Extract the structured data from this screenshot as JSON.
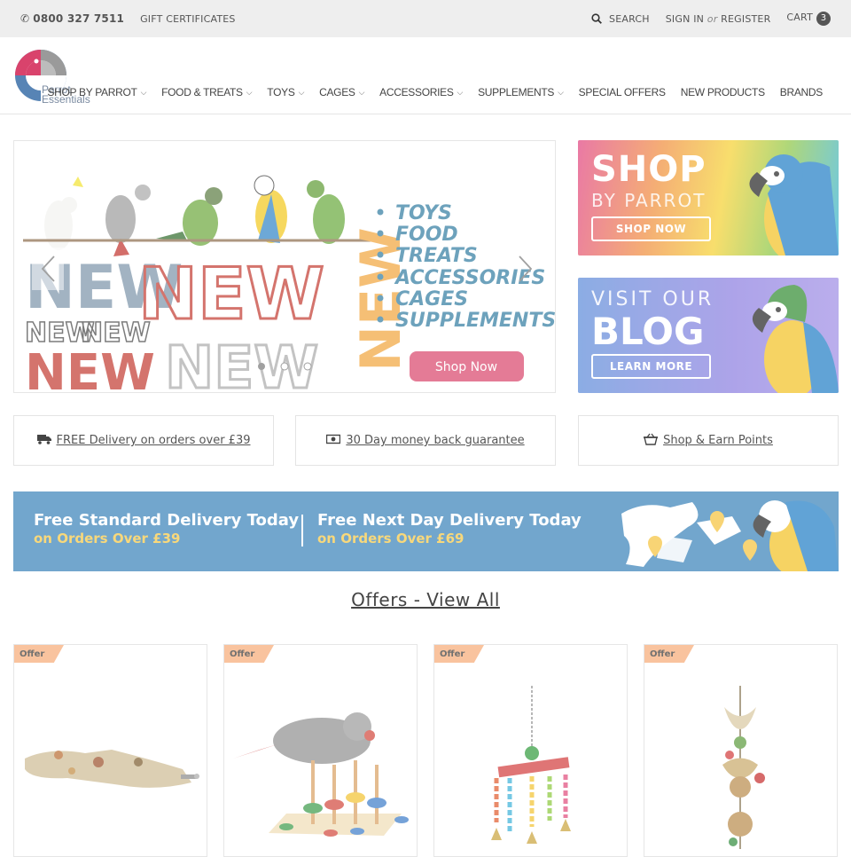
{
  "topbar": {
    "phone": "0800 327 7511",
    "gift": "GIFT CERTIFICATES",
    "search": "SEARCH",
    "sign_in": "SIGN IN",
    "or": "or",
    "register": "REGISTER",
    "cart": "CART",
    "cart_count": "3"
  },
  "logo": {
    "line1": "Parrot",
    "line2": "Essentials"
  },
  "nav": [
    {
      "label": "SHOP BY PARROT",
      "dropdown": true
    },
    {
      "label": "FOOD & TREATS",
      "dropdown": true
    },
    {
      "label": "TOYS",
      "dropdown": true
    },
    {
      "label": "CAGES",
      "dropdown": true
    },
    {
      "label": "ACCESSORIES",
      "dropdown": true
    },
    {
      "label": "SUPPLEMENTS",
      "dropdown": true
    },
    {
      "label": "SPECIAL OFFERS",
      "dropdown": false
    },
    {
      "label": "NEW PRODUCTS",
      "dropdown": false
    },
    {
      "label": "BRANDS",
      "dropdown": false
    }
  ],
  "hero": {
    "list": [
      "TOYS",
      "FOOD",
      "TREATS",
      "ACCESSORIES",
      "CAGES",
      "SUPPLEMENTS"
    ],
    "button": "Shop Now",
    "new_word": "NEW"
  },
  "promo1": {
    "big": "SHOP",
    "small": "BY PARROT",
    "button": "SHOP NOW"
  },
  "promo2": {
    "small": "VISIT OUR",
    "big": "BLOG",
    "button": "LEARN MORE"
  },
  "features": [
    {
      "text": "FREE Delivery on orders over £39",
      "icon": "truck-icon"
    },
    {
      "text": "30 Day money back guarantee",
      "icon": "money-icon"
    },
    {
      "text": "Shop & Earn Points",
      "icon": "basket-icon"
    }
  ],
  "delivery": {
    "left_title": "Free Standard Delivery Today",
    "left_sub": "on Orders Over £39",
    "right_title": "Free Next Day Delivery Today",
    "right_sub": "on Orders Over £69"
  },
  "offers": {
    "title": "Offers - View All",
    "badge": "Offer"
  },
  "colors": {
    "accent": "#3580b8",
    "badge": "#f6a974",
    "shopnow": "#d94369"
  }
}
